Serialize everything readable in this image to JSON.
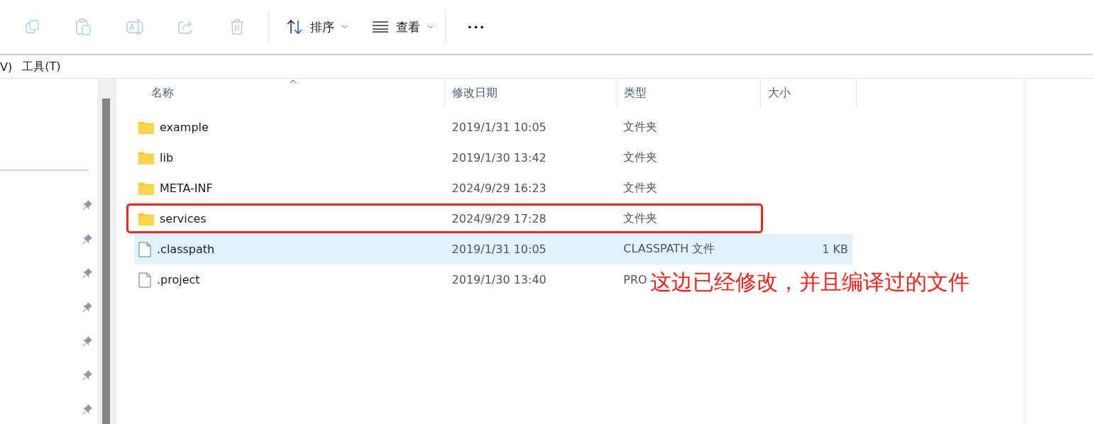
{
  "toolbar": {
    "icon_buttons": [
      {
        "kind": "copy",
        "disabled": true
      },
      {
        "kind": "paste",
        "disabled": true
      },
      {
        "kind": "rename",
        "disabled": true
      },
      {
        "kind": "share",
        "disabled": true
      },
      {
        "kind": "delete",
        "disabled": true
      }
    ],
    "menus": [
      {
        "kind": "sort",
        "label": "排序"
      },
      {
        "kind": "view",
        "label": "查看"
      }
    ],
    "more": "•••"
  },
  "menu_bar": [
    "V)",
    "工具(T)"
  ],
  "nav_pane": {
    "pinned_items": [
      {
        "pinned": true
      },
      {
        "pinned": true
      },
      {
        "pinned": true
      },
      {
        "pinned": true
      },
      {
        "pinned": true
      },
      {
        "pinned": true
      },
      {
        "pinned": true
      }
    ]
  },
  "table": {
    "columns": [
      {
        "label": "名称",
        "sorted": true
      },
      {
        "label": "修改日期",
        "sorted": false
      },
      {
        "label": "类型",
        "sorted": false
      },
      {
        "label": "大小",
        "sorted": false
      }
    ],
    "rows": [
      {
        "kind": "folder",
        "name": "example",
        "date": "2019/1/31 10:05",
        "type": "文件夹",
        "selected": false,
        "highlighted": false
      },
      {
        "kind": "folder",
        "name": "lib",
        "date": "2019/1/30 13:42",
        "type": "文件夹",
        "selected": false,
        "highlighted": false
      },
      {
        "kind": "folder",
        "name": "META-INF",
        "date": "2024/9/29 16:23",
        "type": "文件夹",
        "selected": false,
        "highlighted": false
      },
      {
        "kind": "folder",
        "name": "services",
        "date": "2024/9/29 17:28",
        "type": "文件夹",
        "selected": false,
        "highlighted": true
      },
      {
        "kind": "file",
        "name": ".classpath",
        "date": "2019/1/31 10:05",
        "type": "CLASSPATH 文件",
        "size": "1 KB",
        "selected": true,
        "highlighted": false
      },
      {
        "kind": "file",
        "name": ".project",
        "date": "2019/1/30 13:40",
        "type": "PRO",
        "selected": false,
        "highlighted": false
      }
    ]
  },
  "annotation": "这边已经修改，并且编译过的文件"
}
